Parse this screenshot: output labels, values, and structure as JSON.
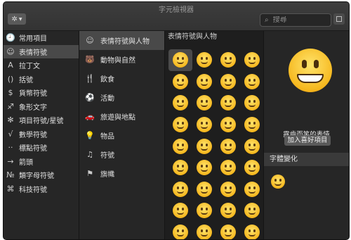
{
  "window": {
    "title": "字元檢視器"
  },
  "toolbar": {
    "search_placeholder": "搜尋"
  },
  "categories": [
    {
      "glyph": "🕘",
      "label": "常用項目",
      "icon": "clock-icon"
    },
    {
      "glyph": "☺",
      "label": "表情符號",
      "icon": "smiley-icon",
      "selected": true
    },
    {
      "glyph": "A",
      "label": "拉丁文",
      "icon": "latin-a-icon"
    },
    {
      "glyph": "()",
      "label": "括號",
      "icon": "parentheses-icon"
    },
    {
      "glyph": "$",
      "label": "貨幣符號",
      "icon": "dollar-icon"
    },
    {
      "glyph": "♐",
      "label": "象形文字",
      "icon": "pictograph-icon"
    },
    {
      "glyph": "✻",
      "label": "項目符號/星號",
      "icon": "asterisk-icon"
    },
    {
      "glyph": "√",
      "label": "數學符號",
      "icon": "square-root-icon"
    },
    {
      "glyph": "··",
      "label": "標點符號",
      "icon": "punctuation-icon"
    },
    {
      "glyph": "→",
      "label": "箭頭",
      "icon": "arrow-icon"
    },
    {
      "glyph": "№",
      "label": "類字母符號",
      "icon": "numero-icon"
    },
    {
      "glyph": "⌘",
      "label": "科技符號",
      "icon": "command-icon"
    }
  ],
  "subcategories": [
    {
      "glyph": "☺",
      "label": "表情符號與人物",
      "icon": "smiley-icon",
      "selected": true
    },
    {
      "glyph": "🐻",
      "label": "動物與自然",
      "icon": "bear-icon"
    },
    {
      "glyph": "🍴",
      "label": "飲食",
      "icon": "food-icon"
    },
    {
      "glyph": "⚽",
      "label": "活動",
      "icon": "ball-icon"
    },
    {
      "glyph": "🚗",
      "label": "旅遊與地點",
      "icon": "car-icon"
    },
    {
      "glyph": "💡",
      "label": "物品",
      "icon": "lightbulb-icon"
    },
    {
      "glyph": "♫",
      "label": "符號",
      "icon": "music-note-icon"
    },
    {
      "glyph": "⚑",
      "label": "旗幟",
      "icon": "flag-icon"
    }
  ],
  "grid": {
    "header": "表情符號與人物",
    "emojis": [
      "😀",
      "😃",
      "😄",
      "😁",
      "😆",
      "😅",
      "😂",
      "🤣",
      "☺️",
      "😊",
      "😇",
      "🙂",
      "🙃",
      "😉",
      "😌",
      "😍",
      "🥰",
      "😘",
      "😗",
      "😙",
      "😚",
      "😋",
      "😛",
      "😝",
      "😜",
      "🤪",
      "🤨",
      "🧐",
      "🤓",
      "😎",
      "🤩",
      "🥳",
      "😏",
      "😒",
      "😞",
      "😔"
    ],
    "selected_index": 0
  },
  "detail": {
    "preview_emoji": "😀",
    "name": "露齒而笑的表情",
    "favorite_button": "加入喜好項目",
    "variations_header": "字體變化",
    "variations": [
      "😀"
    ]
  }
}
